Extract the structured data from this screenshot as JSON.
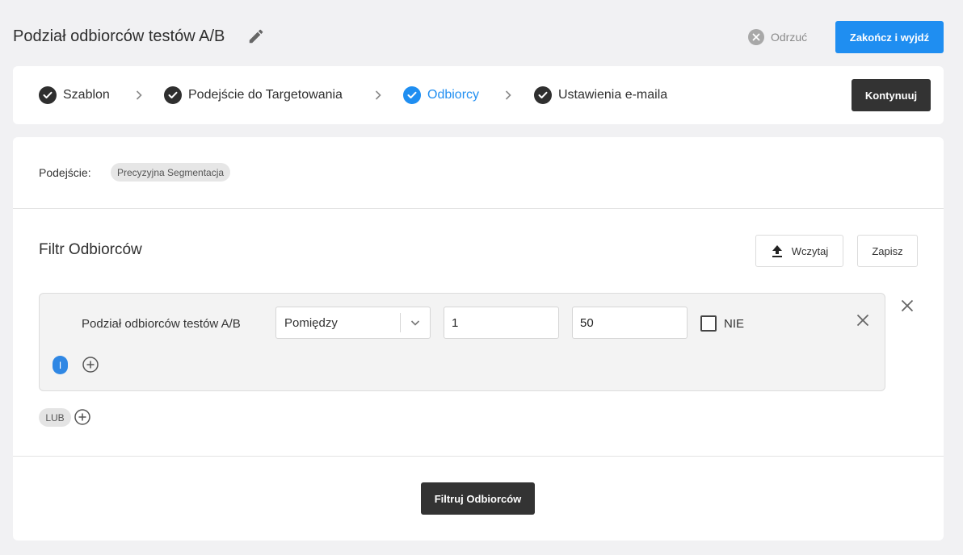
{
  "header": {
    "title": "Podział odbiorców testów A/B",
    "discard_label": "Odrzuć",
    "finish_label": "Zakończ i wyjdź"
  },
  "stepper": {
    "steps": [
      {
        "label": "Szablon",
        "state": "done"
      },
      {
        "label": "Podejście do Targetowania",
        "state": "done"
      },
      {
        "label": "Odbiorcy",
        "state": "active"
      },
      {
        "label": "Ustawienia e-maila",
        "state": "done"
      }
    ],
    "continue_label": "Kontynuuj"
  },
  "approach": {
    "label": "Podejście:",
    "value": "Precyzyjna Segmentacja"
  },
  "filter": {
    "title": "Filtr Odbiorców",
    "load_label": "Wczytaj",
    "save_label": "Zapisz",
    "condition": {
      "field_label": "Podział odbiorców testów A/B",
      "operator": "Pomiędzy",
      "value_from": "1",
      "value_to": "50",
      "not_label": "NIE"
    },
    "and_label": "I",
    "or_label": "LUB",
    "apply_label": "Filtruj Odbiorców"
  },
  "colors": {
    "accent": "#1f8ef1",
    "dark_button": "#333333",
    "page_bg": "#f1f1f3"
  }
}
